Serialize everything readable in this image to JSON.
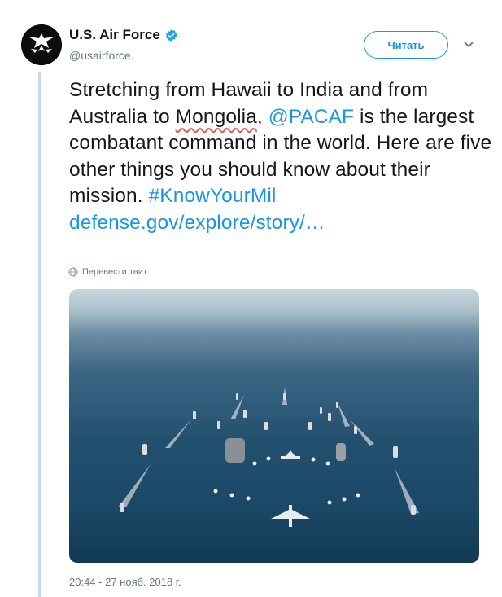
{
  "tweet": {
    "author_name": "U.S. Air Force",
    "author_handle": "@usairforce",
    "follow_label": "Читать",
    "text_part1": "Stretching from Hawaii to India and from Australia to ",
    "text_misspelled": "Mongolia",
    "text_part2": ", ",
    "mention": "@PACAF",
    "text_part3": " is the largest combatant command in the world. Here are five other things you should know about their mission. ",
    "hashtag": "#KnowYourMil",
    "link": "defense.gov/explore/story/…",
    "translate_label": "Перевести твит",
    "timestamp": "20:44 - 27 нояб. 2018 г."
  },
  "colors": {
    "link": "#1b95e0",
    "text": "#14171a",
    "secondary": "#657786",
    "thread_line": "#c5d9ee"
  },
  "icons": [
    "air-force-logo",
    "verified-badge-icon",
    "chevron-down-icon",
    "globe-icon"
  ]
}
